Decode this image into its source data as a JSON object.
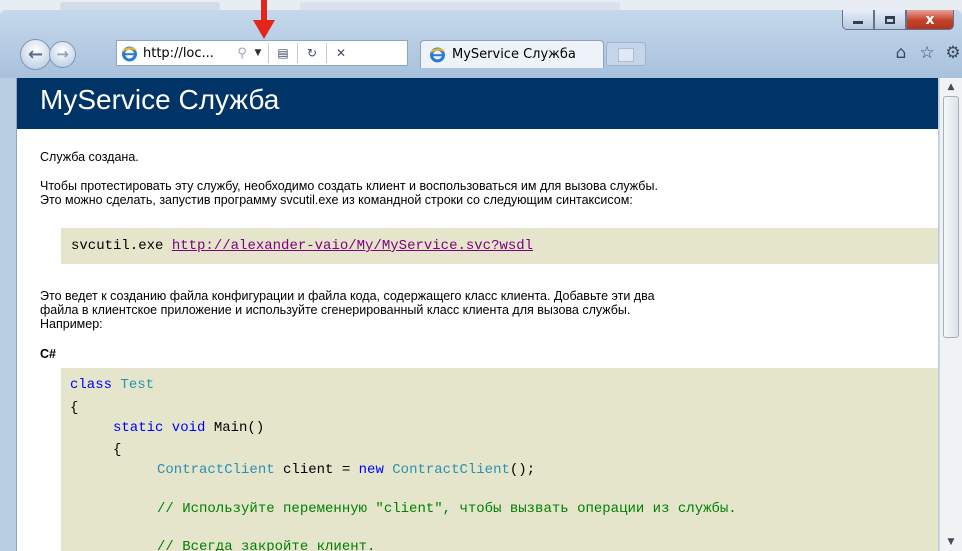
{
  "browser": {
    "address_url": "http://loc...",
    "tab_title": "MyService Служба",
    "window_buttons": {
      "close": "x"
    }
  },
  "page": {
    "heading": "MyService Служба",
    "created_text": "Служба создана.",
    "instructions_line1": "Чтобы протестировать эту службу, необходимо создать клиент и воспользоваться им для вызова службы.",
    "instructions_line2": "Это можно сделать, запустив программу svcutil.exe из командной строки со следующим синтаксисом:",
    "command": {
      "program": "svcutil.exe ",
      "url": "http://alexander-vaio/My/MyService.svc?wsdl"
    },
    "result_line1": "Это ведет к созданию файла конфигурации и файла кода, содержащего класс клиента. Добавьте эти два",
    "result_line2": "файла в клиентское приложение и используйте сгенерированный класс клиента для вызова службы.",
    "result_line3": "Например:",
    "language_label": "C#",
    "code": {
      "l1_kw": "class",
      "l1_type": "Test",
      "l2": "{",
      "l3_kw": "static void",
      "l3_rest": " Main()",
      "l4": "{",
      "l5_type": "ContractClient",
      "l5_mid": " client = ",
      "l5_kw": "new",
      "l5_type2": "ContractClient",
      "l5_end": "();",
      "l6_comment": "// Используйте переменную \"client\", чтобы вызвать операции из службы.",
      "l7_comment": "// Всегда закройте клиент."
    }
  },
  "colors": {
    "banner": "#003366",
    "code_background": "#e5e5cc",
    "keyword": "#0000ff",
    "type": "#2b91af",
    "comment": "#008000",
    "link": "#800080",
    "annotation_arrow": "#e3261c"
  },
  "icons": {
    "back": "back-arrow-icon",
    "forward": "forward-arrow-icon",
    "search": "search-icon",
    "compat": "compatibility-view-icon",
    "refresh": "refresh-icon",
    "stop": "stop-icon",
    "home": "home-icon",
    "favorites": "star-icon",
    "tools": "gear-icon"
  }
}
